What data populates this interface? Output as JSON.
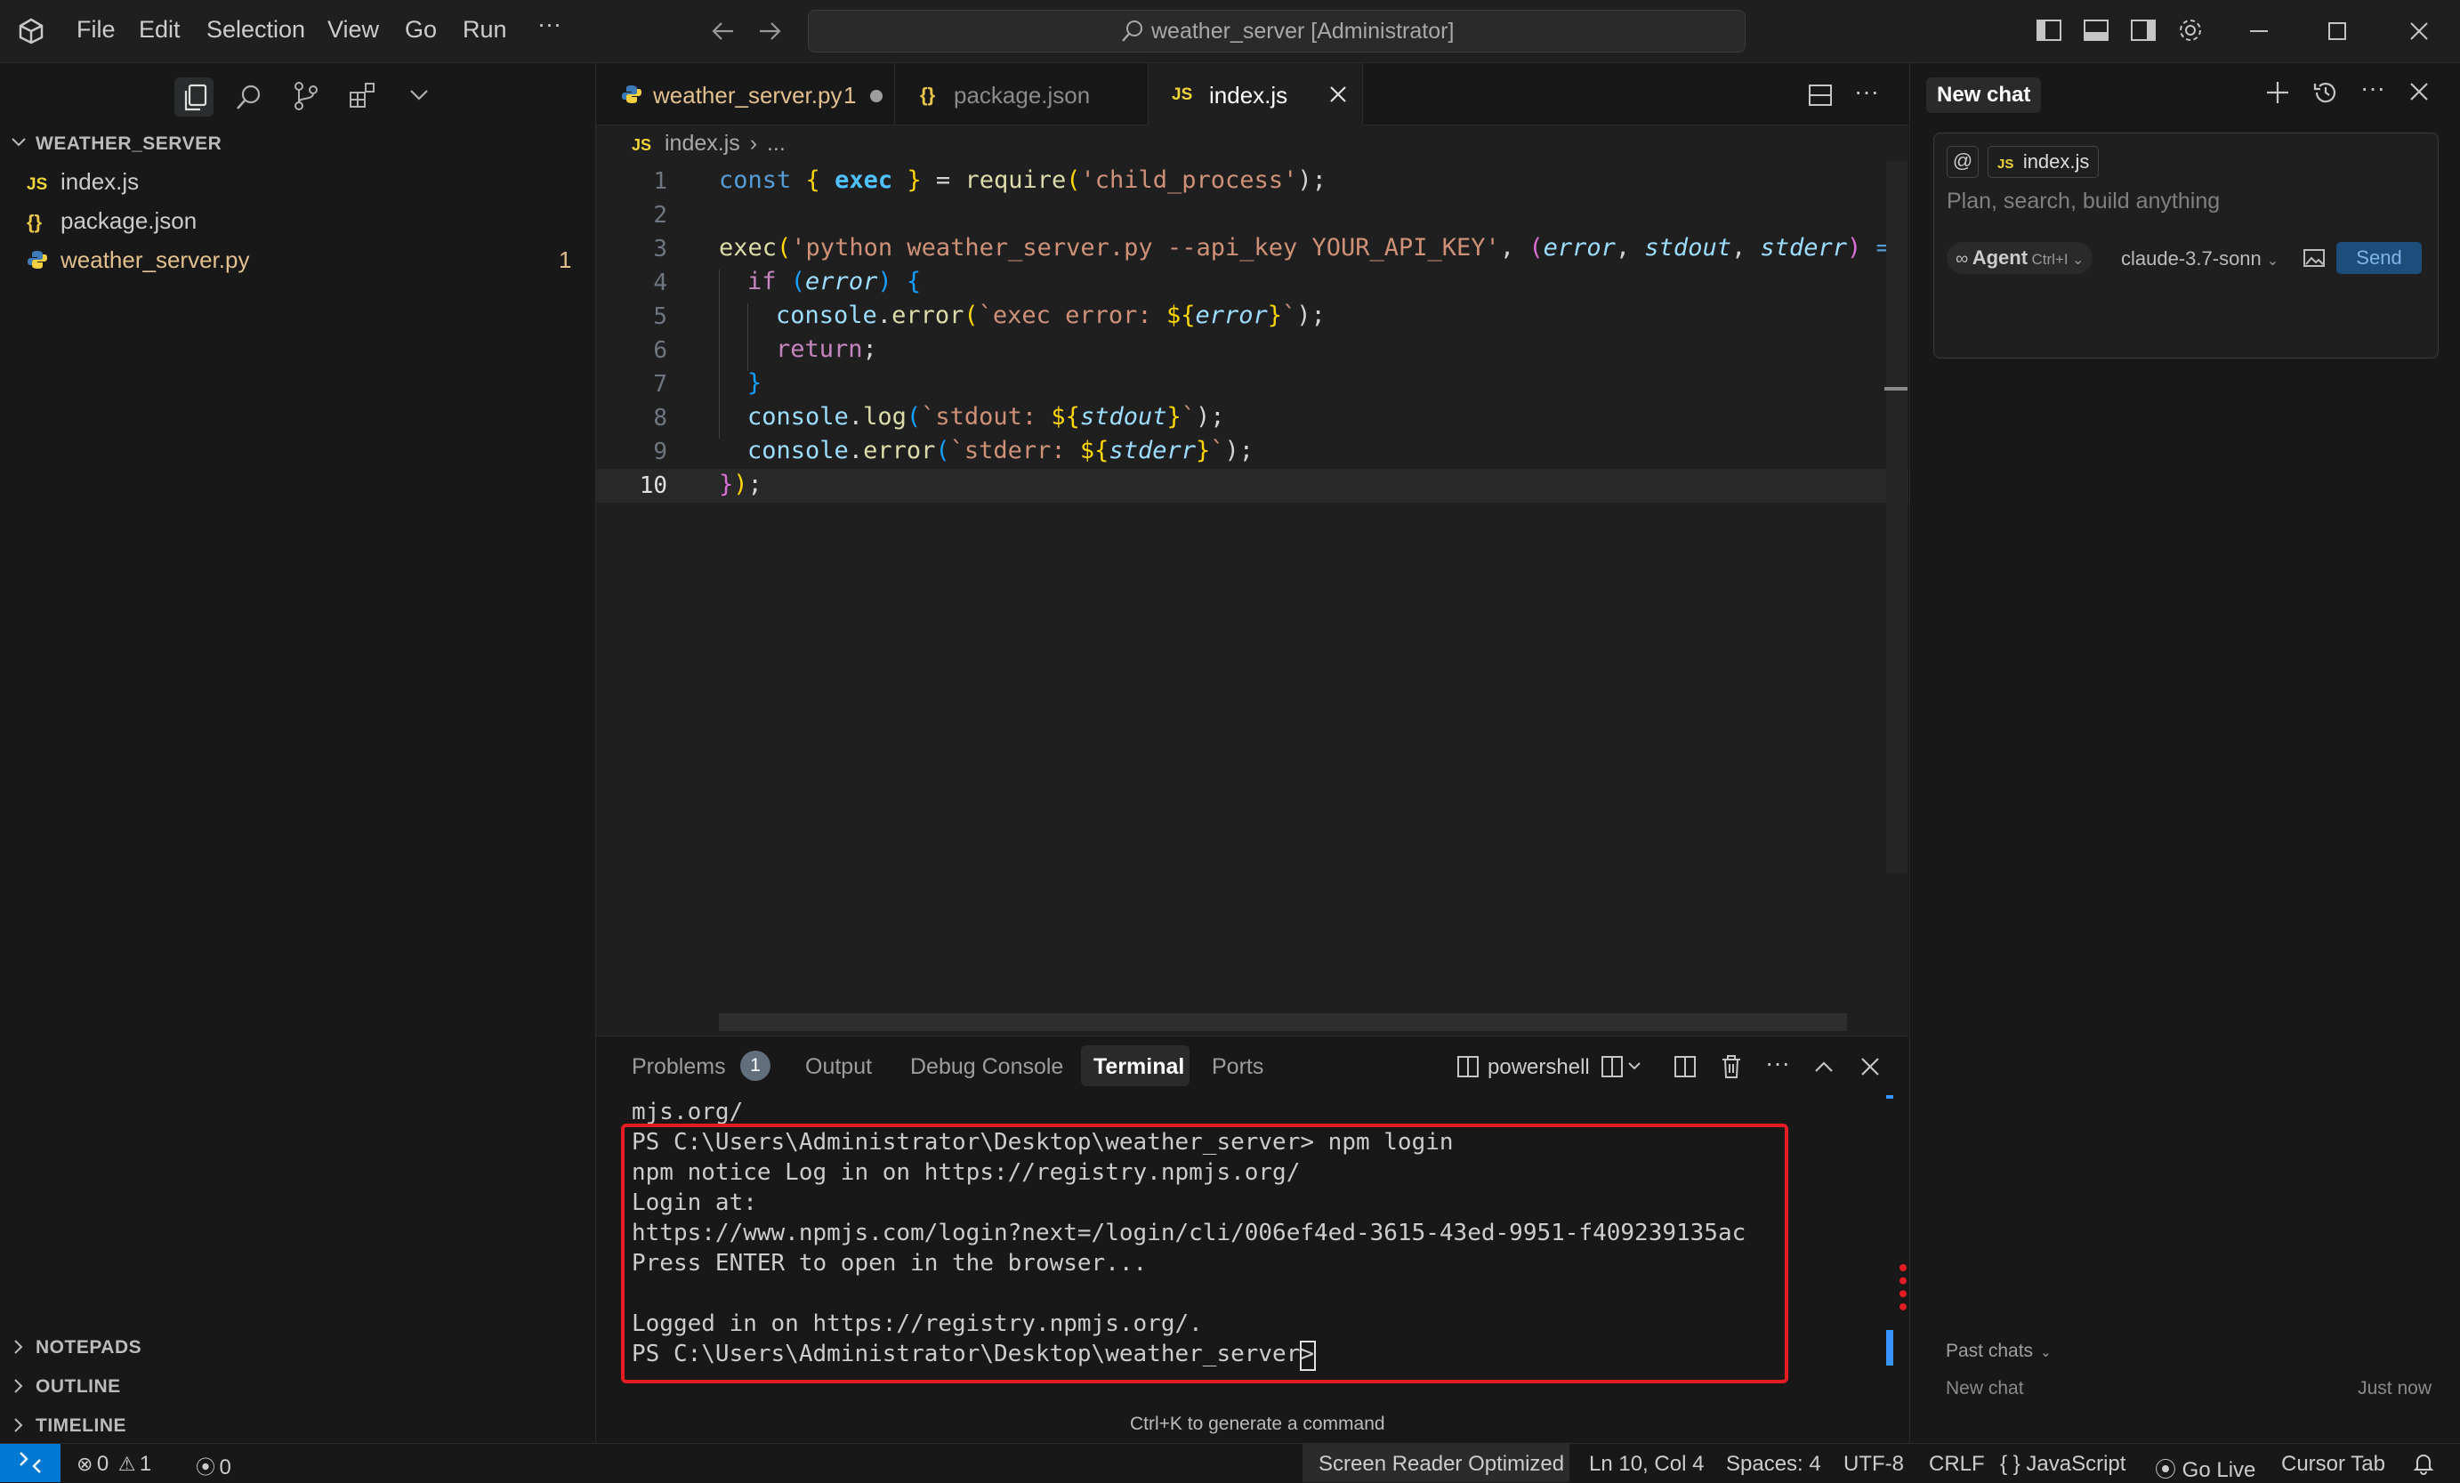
{
  "titlebar": {
    "menu": [
      "File",
      "Edit",
      "Selection",
      "View",
      "Go",
      "Run",
      "···"
    ],
    "search_text": "weather_server [Administrator]"
  },
  "explorer": {
    "folder_name": "WEATHER_SERVER",
    "files": [
      {
        "icon": "JS",
        "name": "index.js",
        "badge": ""
      },
      {
        "icon": "{}",
        "name": "package.json",
        "badge": ""
      },
      {
        "icon": "py",
        "name": "weather_server.py",
        "badge": "1"
      }
    ],
    "bottom_sections": [
      "NOTEPADS",
      "OUTLINE",
      "TIMELINE"
    ]
  },
  "editor": {
    "tabs": [
      {
        "icon": "py",
        "label": "weather_server.py",
        "badge": "1"
      },
      {
        "icon": "{}",
        "label": "package.json"
      },
      {
        "icon": "JS",
        "label": "index.js"
      }
    ],
    "breadcrumb": {
      "icon": "JS",
      "file": "index.js",
      "rest": "..."
    },
    "line_numbers": [
      "1",
      "2",
      "3",
      "4",
      "5",
      "6",
      "7",
      "8",
      "9",
      "10"
    ],
    "code": {
      "l1": {
        "a": "const",
        "b": "{",
        "c": "exec",
        "d": "}",
        "e": "=",
        "f": "require",
        "g": "(",
        "h": "'child_process'",
        "i": ");"
      },
      "l3": {
        "a": "exec",
        "b": "(",
        "c": "'python weather_server.py --api_key YOUR_API_KEY'",
        "d": ",",
        "e": "(",
        "f": "error",
        "g": ",",
        "h": "stdout",
        "i": ",",
        "j": "stderr",
        "k": ")",
        "l": "=>",
        "m": "{"
      },
      "l4": {
        "a": "if",
        "b": "(",
        "c": "error",
        "d": ")",
        "e": "{"
      },
      "l5": {
        "a": "console",
        "b": ".",
        "c": "error",
        "d": "(",
        "e": "`exec error: ",
        "f": "${",
        "g": "error",
        "h": "}",
        "i": "`",
        "j": ");"
      },
      "l6": {
        "a": "return",
        "b": ";"
      },
      "l7": {
        "a": "}"
      },
      "l8": {
        "a": "console",
        "b": ".",
        "c": "log",
        "d": "(",
        "e": "`stdout: ",
        "f": "${",
        "g": "stdout",
        "h": "}",
        "i": "`",
        "j": ");"
      },
      "l9": {
        "a": "console",
        "b": ".",
        "c": "error",
        "d": "(",
        "e": "`stderr: ",
        "f": "${",
        "g": "stderr",
        "h": "}",
        "i": "`",
        "j": ");"
      },
      "l10": {
        "a": "}",
        "b": ")",
        "c": ";"
      }
    }
  },
  "panel": {
    "tabs": [
      "Problems",
      "Output",
      "Debug Console",
      "Terminal",
      "Ports"
    ],
    "problems_count": "1",
    "shell": "powershell",
    "terminal_lines": [
      "mjs.org/",
      "PS C:\\Users\\Administrator\\Desktop\\weather_server> npm login",
      "npm notice Log in on https://registry.npmjs.org/",
      "Login at:",
      "https://www.npmjs.com/login?next=/login/cli/006ef4ed-3615-43ed-9951-f409239135ac",
      "Press ENTER to open in the browser...",
      "",
      "Logged in on https://registry.npmjs.org/.",
      "PS C:\\Users\\Administrator\\Desktop\\weather_server> "
    ],
    "terminal_hint": "Ctrl+K to generate a command",
    "highlight_color": "#e51c23"
  },
  "chat": {
    "title": "New chat",
    "context_chip": "index.js",
    "placeholder": "Plan, search, build anything",
    "agent_label": "Agent",
    "agent_shortcut": "Ctrl+I",
    "model": "claude-3.7-sonn",
    "send_label": "Send",
    "past_chats_label": "Past chats",
    "past_chats": [
      {
        "title": "New chat",
        "time": "Just now"
      }
    ]
  },
  "statusbar": {
    "errors": "0",
    "warnings": "1",
    "ports": "0",
    "items": [
      "Screen Reader Optimized",
      "Ln 10, Col 4",
      "Spaces: 4",
      "UTF-8",
      "CRLF",
      "JavaScript",
      "Go Live",
      "Cursor Tab"
    ],
    "remote_color": "#0078d4"
  }
}
